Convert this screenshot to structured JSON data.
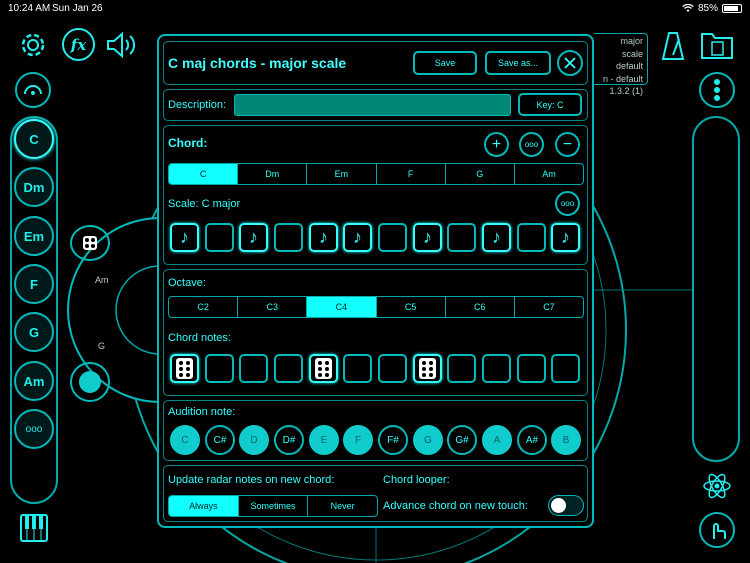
{
  "status": {
    "time": "10:24 AM",
    "date": "Sun Jan 26",
    "battery": "85%"
  },
  "background": {
    "info_lines": [
      "major scale",
      "default",
      "n - default",
      "1.3.2 (1)"
    ],
    "radar_labels": [
      "Am",
      "G"
    ]
  },
  "left_chords": [
    "C",
    "Dm",
    "Em",
    "F",
    "G",
    "Am",
    "ooo"
  ],
  "dialog": {
    "title": "C maj chords  - major scale",
    "save_label": "Save",
    "save_as_label": "Save as...",
    "description_label": "Description:",
    "description_value": "",
    "key_label": "Key: C",
    "chord_label": "Chord:",
    "add_glyph": "+",
    "more_glyph": "ooo",
    "remove_glyph": "−",
    "chords": [
      "C",
      "Dm",
      "Em",
      "F",
      "G",
      "Am"
    ],
    "selected_chord": "C",
    "scale_label": "Scale: C major",
    "scale_steps": [
      true,
      false,
      true,
      false,
      true,
      true,
      false,
      true,
      false,
      true,
      false,
      true
    ],
    "octave_label": "Octave:",
    "octaves": [
      "C2",
      "C3",
      "C4",
      "C5",
      "C6",
      "C7"
    ],
    "selected_octave": "C4",
    "chord_notes_label": "Chord notes:",
    "chord_notes": [
      true,
      false,
      false,
      false,
      true,
      false,
      false,
      true,
      false,
      false,
      false,
      false
    ],
    "audition_label": "Audition note:",
    "audition_notes": [
      {
        "n": "C",
        "on": true
      },
      {
        "n": "C#",
        "on": false
      },
      {
        "n": "D",
        "on": true
      },
      {
        "n": "D#",
        "on": false
      },
      {
        "n": "E",
        "on": true
      },
      {
        "n": "F",
        "on": true
      },
      {
        "n": "F#",
        "on": false
      },
      {
        "n": "G",
        "on": true
      },
      {
        "n": "G#",
        "on": false
      },
      {
        "n": "A",
        "on": true
      },
      {
        "n": "A#",
        "on": false
      },
      {
        "n": "B",
        "on": true
      }
    ],
    "update_label": "Update radar notes on new chord:",
    "update_options": [
      "Always",
      "Sometimes",
      "Never"
    ],
    "update_selected": "Always",
    "looper_label": "Chord looper:",
    "advance_label": "Advance chord on new touch:",
    "advance_on": false
  },
  "colors": {
    "accent": "#22e8e8",
    "dark_accent": "#00aaaa",
    "bg": "#000000"
  }
}
